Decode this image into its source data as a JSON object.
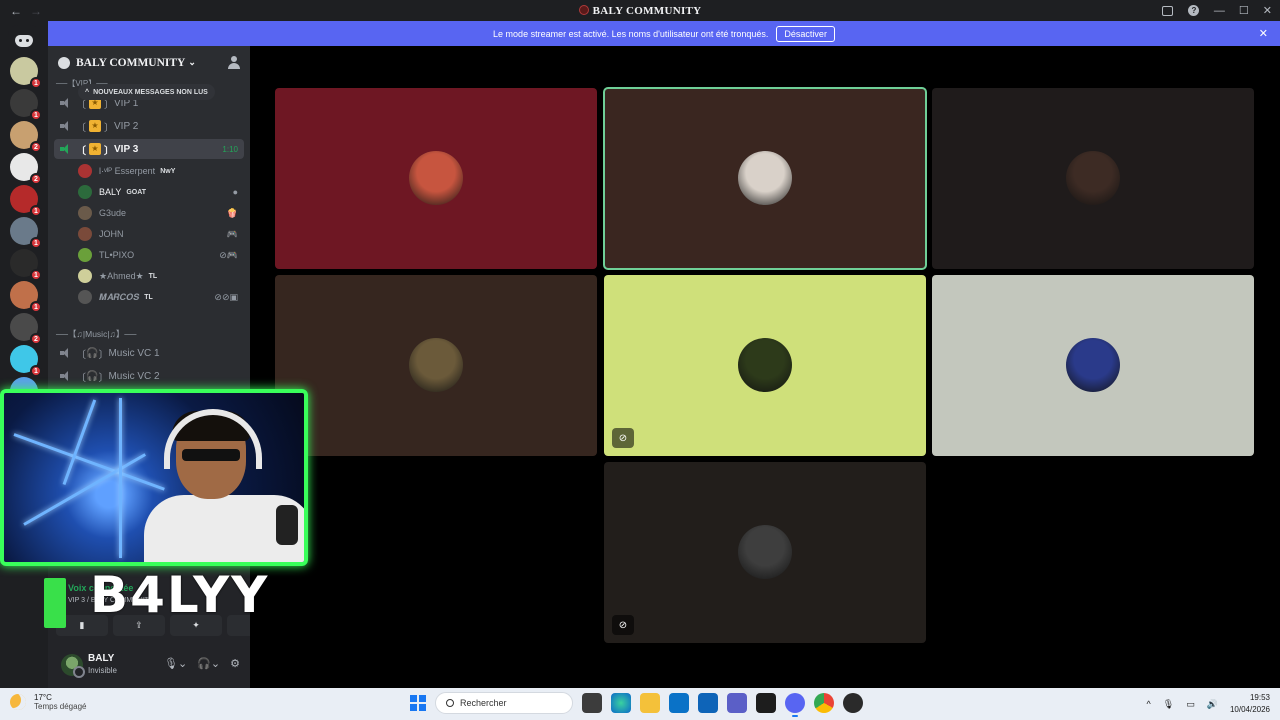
{
  "titlebar": {
    "title": "BALY COMMUNITY",
    "back": "←",
    "forward": "→",
    "minimize": "—",
    "maximize": "☐",
    "close": "✕"
  },
  "banner": {
    "text": "Le mode streamer est activé. Les noms d'utilisateur ont été tronqués.",
    "button": "Désactiver",
    "close": "✕"
  },
  "rail": {
    "badges": [
      "1",
      "1",
      "2",
      "2",
      "1",
      "1",
      "1",
      "1",
      "2",
      "1",
      "1"
    ]
  },
  "sidebar": {
    "server_name": "BALY COMMUNITY",
    "new_messages_pill": "NOUVEAUX MESSAGES NON LUS",
    "category_vip": "──【VIP】──",
    "voice_channels": [
      {
        "label": "VIP 1"
      },
      {
        "label": "VIP 2"
      },
      {
        "label": "VIP 3",
        "timer": "1:10"
      }
    ],
    "members": [
      {
        "name": "l·ᵛᴵᴾ Esserpent",
        "tag": "NwY",
        "icon": ""
      },
      {
        "name": "BALY",
        "tag": "GOAT",
        "icon": "●"
      },
      {
        "name": "G3ude",
        "tag": "",
        "icon": "🍿"
      },
      {
        "name": "JOHN",
        "tag": "",
        "icon": "🎮"
      },
      {
        "name": "TL•PIXO",
        "tag": "",
        "icon": "⊘🎮"
      },
      {
        "name": "★Ahmed★",
        "tag": "TL",
        "icon": ""
      },
      {
        "name": "𝑴𝑨𝑹𝑪𝑶𝑺",
        "tag": "TL",
        "icon": "⊘⊘▣"
      }
    ],
    "category_music": "──【♫|Music|♫】──",
    "music_channels": [
      {
        "label": "Music VC 1"
      },
      {
        "label": "Music VC 2"
      }
    ]
  },
  "voice_panel": {
    "status": "Voix connectée",
    "channel": "VIP 3 / BALY COMMUNITY"
  },
  "user_panel": {
    "name": "BALY",
    "status": "Invisible"
  },
  "overlay": {
    "streamer_name": "B4LYY"
  },
  "tiles": [
    {
      "color": "#6e1723",
      "avatar": "#c7553f",
      "speaking": false,
      "muted": false
    },
    {
      "color": "#3a2620",
      "avatar": "#d9d1c9",
      "speaking": true,
      "muted": false
    },
    {
      "color": "#1f1b1b",
      "avatar": "#3d2b24",
      "speaking": false,
      "muted": false
    },
    {
      "color": "#36261f",
      "avatar": "#6b5a3a",
      "speaking": false,
      "muted": false
    },
    {
      "color": "#cfe07a",
      "avatar": "#2d3a1a",
      "speaking": false,
      "muted": true
    },
    {
      "color": "#c3c7bd",
      "avatar": "#2a3a8a",
      "speaking": false,
      "muted": false
    },
    {
      "color": "#221e1b",
      "avatar": "#3e3e3e",
      "speaking": false,
      "muted": true
    }
  ],
  "taskbar": {
    "temperature": "17°C",
    "weather": "Temps dégagé",
    "search_placeholder": "Rechercher",
    "time": "19:53",
    "date": "10/04/2026"
  }
}
